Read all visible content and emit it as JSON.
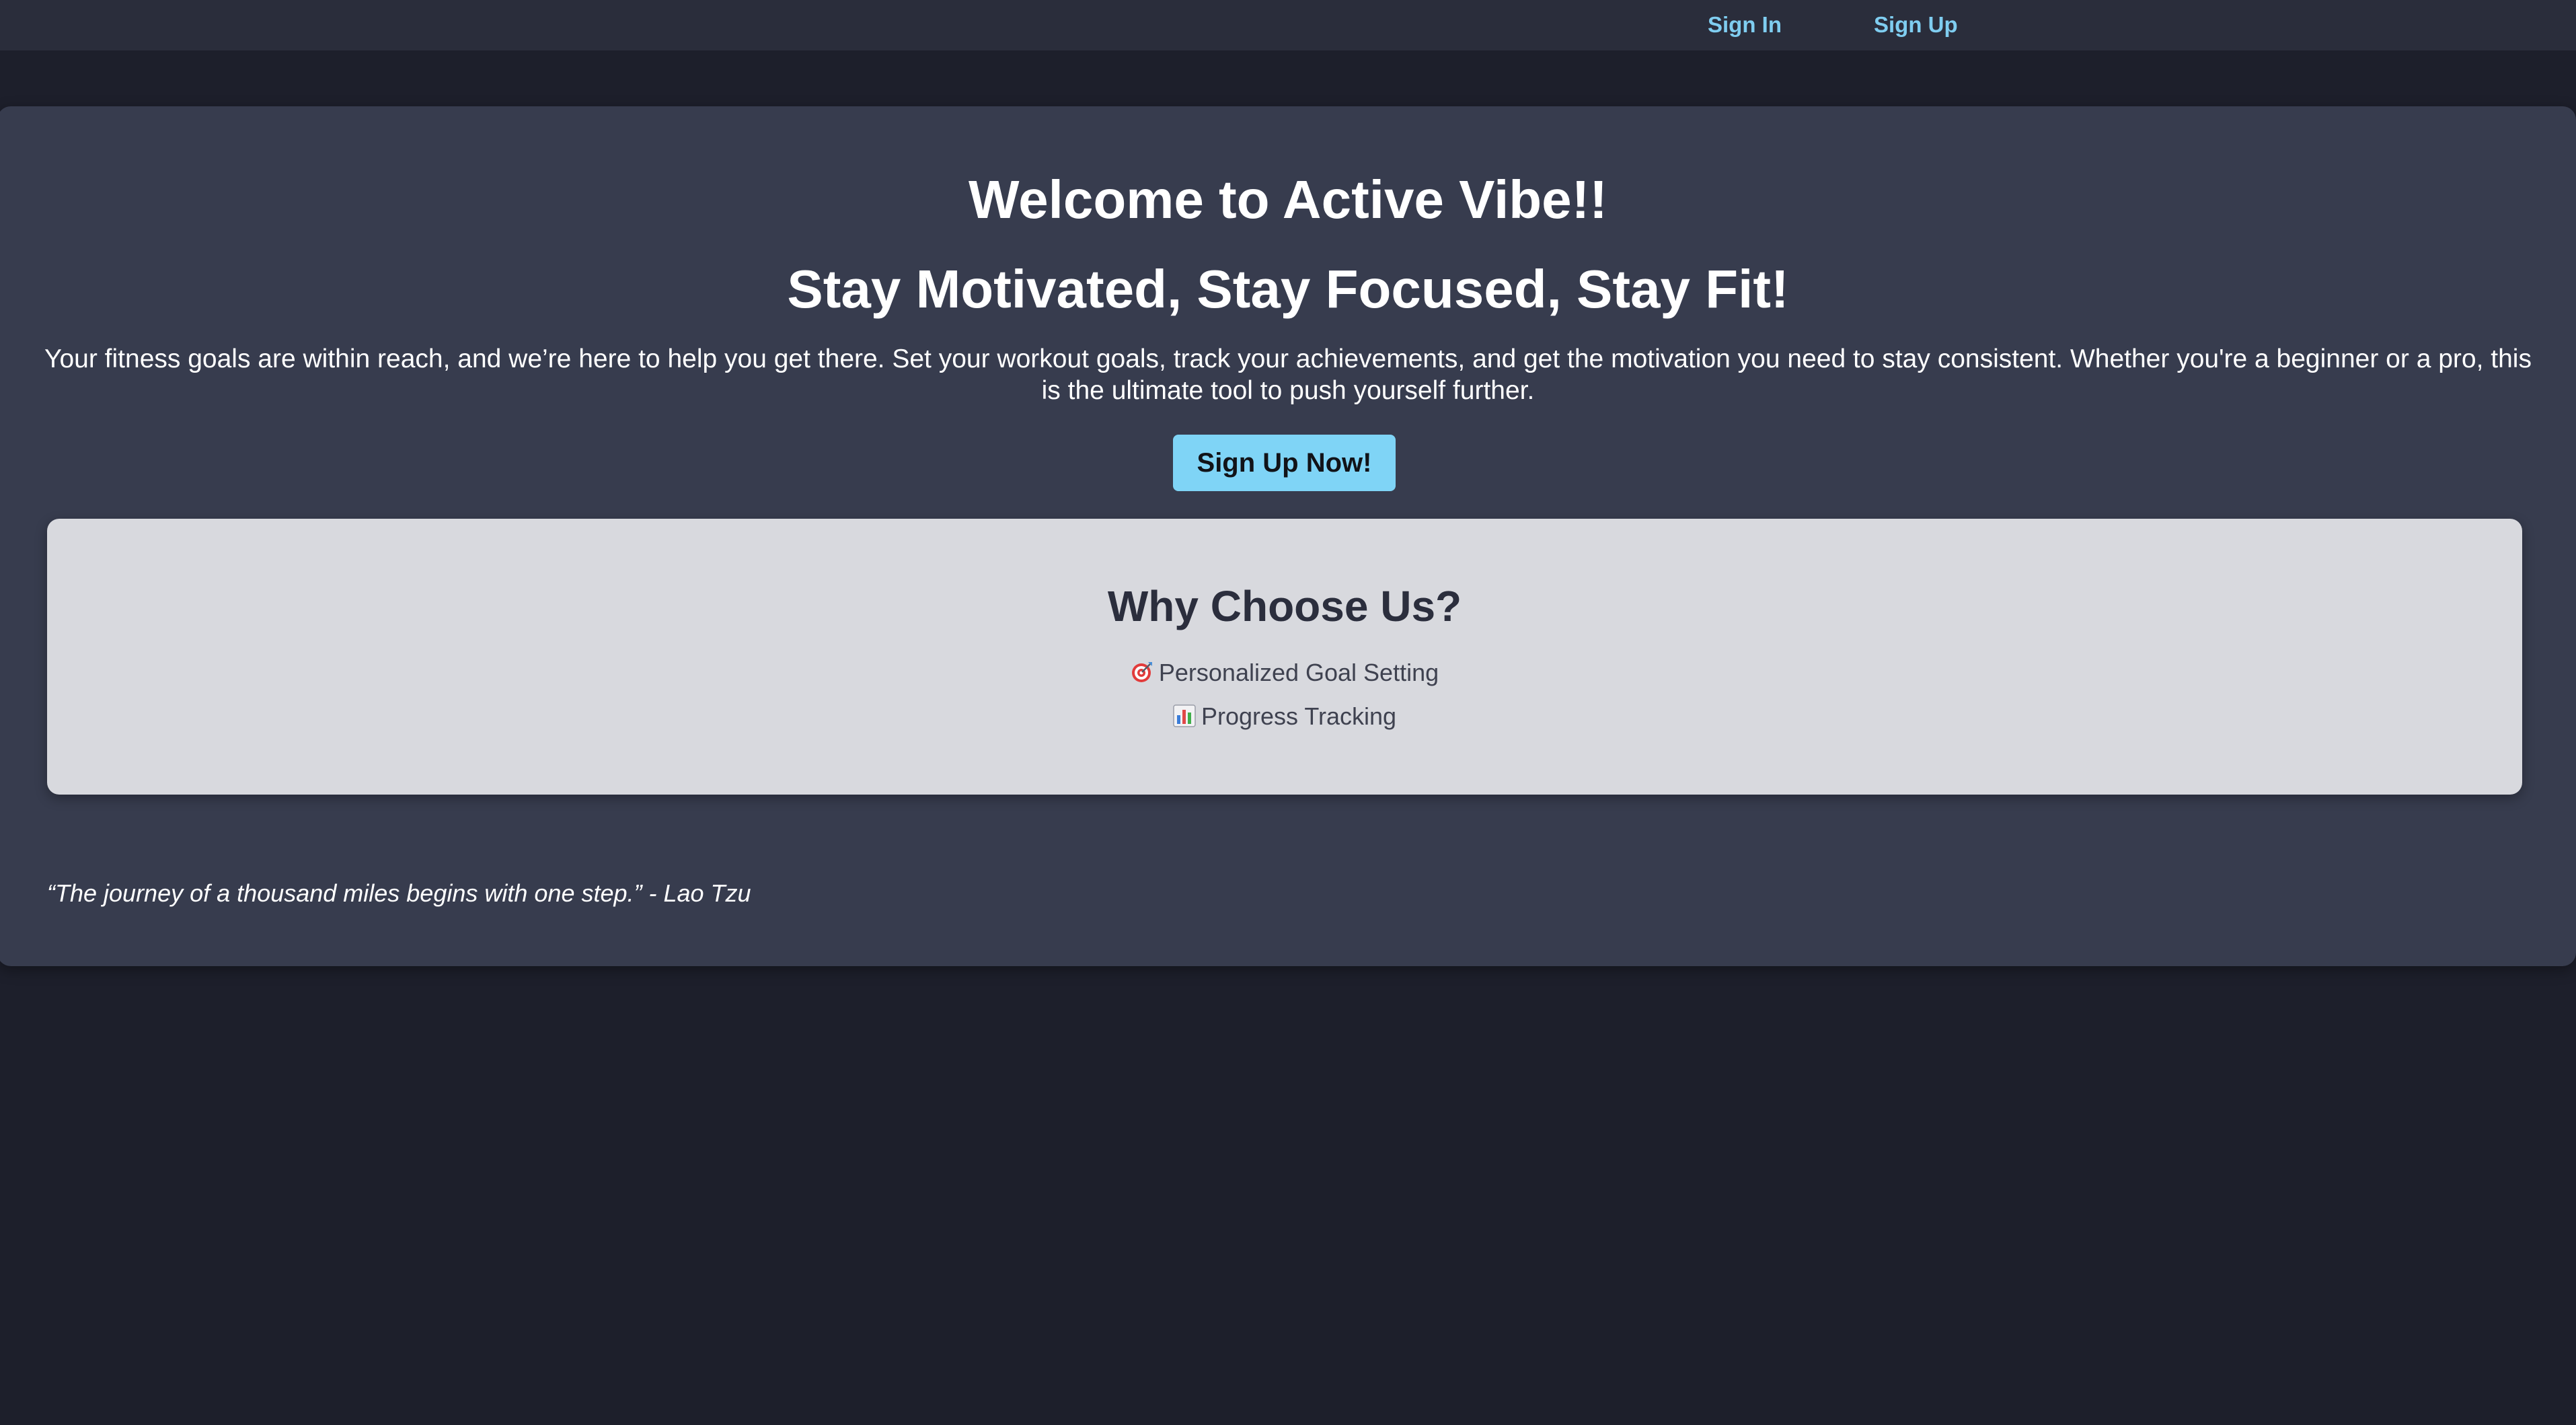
{
  "nav": {
    "sign_in": "Sign In",
    "sign_up": "Sign Up"
  },
  "hero": {
    "title": "Welcome to Active Vibe!!",
    "subtitle": "Stay Motivated, Stay Focused, Stay Fit!",
    "description": "Your fitness goals are within reach, and we’re here to help you get there. Set your workout goals, track your achievements, and get the motivation you need to stay consistent. Whether you're a beginner or a pro, this is the ultimate tool to push yourself further.",
    "cta_label": "Sign Up Now!"
  },
  "features": {
    "title": "Why Choose Us?",
    "items": [
      {
        "icon": "target-icon",
        "label": "Personalized Goal Setting"
      },
      {
        "icon": "bar-chart-icon",
        "label": "Progress Tracking"
      }
    ]
  },
  "quote": {
    "text": "“The journey of a thousand miles begins with one step.” - Lao Tzu"
  },
  "colors": {
    "background": "#1d1f2b",
    "topbar": "#2a2d3b",
    "hero_card": "#373c4e",
    "accent": "#7fd4f6",
    "features_card": "#d8d9de"
  }
}
